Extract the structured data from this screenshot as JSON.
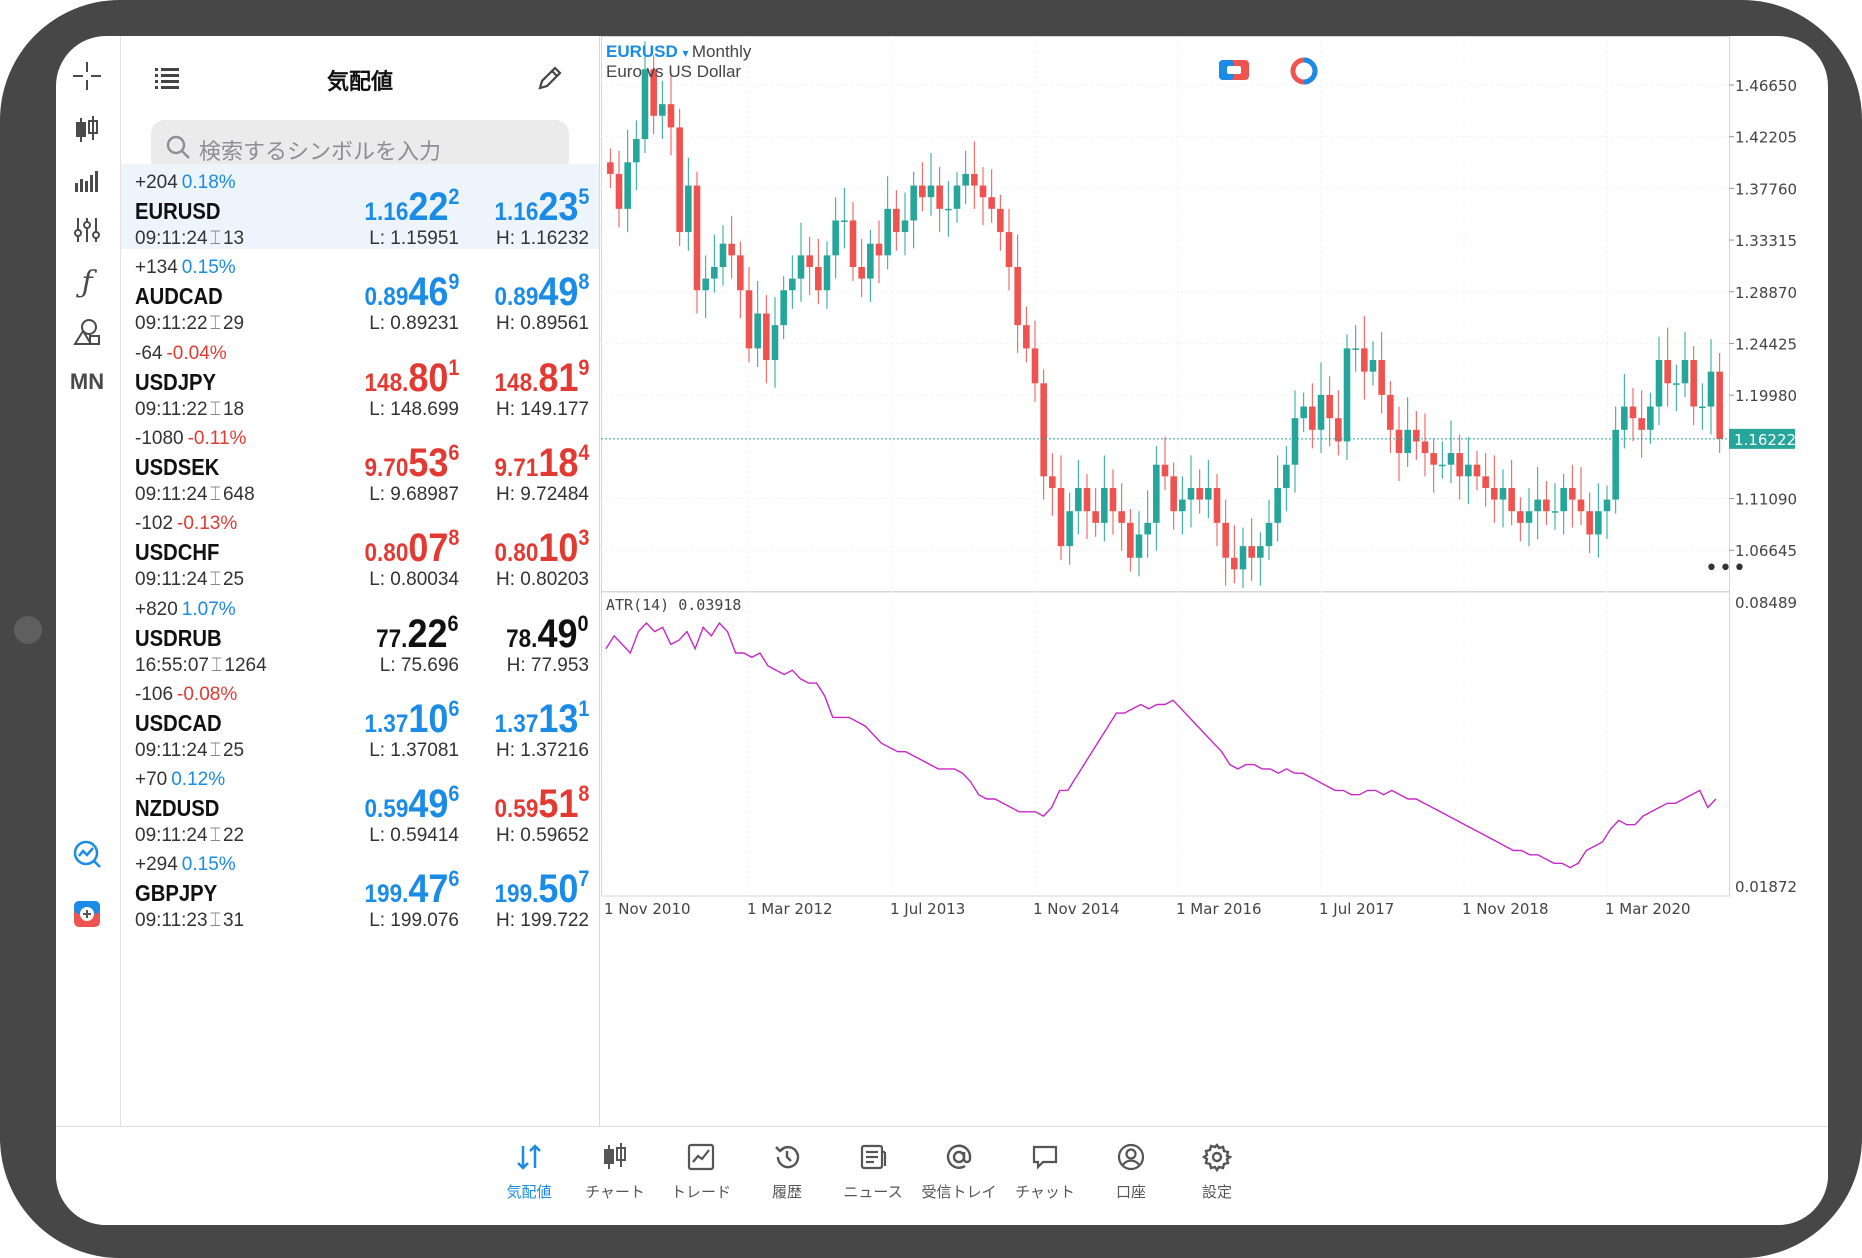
{
  "quotes_panel": {
    "title": "気配値",
    "search_placeholder": "検索するシンボルを入力",
    "rows": [
      {
        "change": "+204",
        "pct": "0.18%",
        "pct_color": "blue",
        "symbol": "EURUSD",
        "time": "09:11:24",
        "spread": "13",
        "bid": {
          "a": "1.16",
          "b": "22",
          "c": "2"
        },
        "ask": {
          "a": "1.16",
          "b": "23",
          "c": "5"
        },
        "price_color": "blue",
        "low": "L: 1.15951",
        "high": "H: 1.16232",
        "selected": true
      },
      {
        "change": "+134",
        "pct": "0.15%",
        "pct_color": "blue",
        "symbol": "AUDCAD",
        "time": "09:11:22",
        "spread": "29",
        "bid": {
          "a": "0.89",
          "b": "46",
          "c": "9"
        },
        "ask": {
          "a": "0.89",
          "b": "49",
          "c": "8"
        },
        "price_color": "blue",
        "low": "L: 0.89231",
        "high": "H: 0.89561"
      },
      {
        "change": "-64",
        "pct": "-0.04%",
        "pct_color": "red",
        "symbol": "USDJPY",
        "time": "09:11:22",
        "spread": "18",
        "bid": {
          "a": "148.",
          "b": "80",
          "c": "1"
        },
        "ask": {
          "a": "148.",
          "b": "81",
          "c": "9"
        },
        "price_color": "red",
        "low": "L: 148.699",
        "high": "H: 149.177"
      },
      {
        "change": "-1080",
        "pct": "-0.11%",
        "pct_color": "red",
        "symbol": "USDSEK",
        "time": "09:11:24",
        "spread": "648",
        "bid": {
          "a": "9.70",
          "b": "53",
          "c": "6"
        },
        "ask": {
          "a": "9.71",
          "b": "18",
          "c": "4"
        },
        "price_color": "red",
        "low": "L: 9.68987",
        "high": "H: 9.72484"
      },
      {
        "change": "-102",
        "pct": "-0.13%",
        "pct_color": "red",
        "symbol": "USDCHF",
        "time": "09:11:24",
        "spread": "25",
        "bid": {
          "a": "0.80",
          "b": "07",
          "c": "8"
        },
        "ask": {
          "a": "0.80",
          "b": "10",
          "c": "3"
        },
        "price_color": "red",
        "low": "L: 0.80034",
        "high": "H: 0.80203"
      },
      {
        "change": "+820",
        "pct": "1.07%",
        "pct_color": "blue",
        "symbol": "USDRUB",
        "time": "16:55:07",
        "spread": "1264",
        "bid": {
          "a": "77.",
          "b": "22",
          "c": "6"
        },
        "ask": {
          "a": "78.",
          "b": "49",
          "c": "0"
        },
        "price_color": "black",
        "low": "L: 75.696",
        "high": "H: 77.953"
      },
      {
        "change": "-106",
        "pct": "-0.08%",
        "pct_color": "red",
        "symbol": "USDCAD",
        "time": "09:11:24",
        "spread": "25",
        "bid": {
          "a": "1.37",
          "b": "10",
          "c": "6"
        },
        "ask": {
          "a": "1.37",
          "b": "13",
          "c": "1"
        },
        "price_color": "blue",
        "low": "L: 1.37081",
        "high": "H: 1.37216"
      },
      {
        "change": "+70",
        "pct": "0.12%",
        "pct_color": "blue",
        "symbol": "NZDUSD",
        "time": "09:11:24",
        "spread": "22",
        "bid": {
          "a": "0.59",
          "b": "49",
          "c": "6"
        },
        "ask": {
          "a": "0.59",
          "b": "51",
          "c": "8"
        },
        "price_color": "mixed",
        "low": "L: 0.59414",
        "high": "H: 0.59652"
      },
      {
        "change": "+294",
        "pct": "0.15%",
        "pct_color": "blue",
        "symbol": "GBPJPY",
        "time": "09:11:23",
        "spread": "31",
        "bid": {
          "a": "199.",
          "b": "47",
          "c": "6"
        },
        "ask": {
          "a": "199.",
          "b": "50",
          "c": "7"
        },
        "price_color": "blue",
        "low": "L: 199.076",
        "high": "H: 199.722"
      }
    ]
  },
  "toolbar": {
    "mn_label": "MN",
    "icons": [
      "crosshair-icon",
      "candlestick-icon",
      "bar-chart-icon",
      "indicators-icon",
      "function-icon",
      "objects-icon",
      "timeframe-mn",
      "trade-chart-icon",
      "one-click-trading-icon"
    ]
  },
  "chart": {
    "symbol": "EURUSD",
    "timeframe": "Monthly",
    "description": "Euro vs US Dollar",
    "current_price": "1.16222",
    "price_ticks": [
      "1.46650",
      "1.42205",
      "1.37760",
      "1.33315",
      "1.28870",
      "1.24425",
      "1.19980",
      "1.11090",
      "1.06645"
    ],
    "date_ticks": [
      "1 Nov 2010",
      "1 Mar 2012",
      "1 Jul 2013",
      "1 Nov 2014",
      "1 Mar 2016",
      "1 Jul 2017",
      "1 Nov 2018",
      "1 Mar 2020"
    ],
    "atr_label": "ATR(14) 0.03918",
    "atr_ticks": [
      "0.08489",
      "0.01872"
    ],
    "colors": {
      "up": "#26a69a",
      "down": "#ef5350",
      "atr": "#c728c7",
      "accent": "#1a8be6"
    }
  },
  "chart_data": {
    "type": "candlestick",
    "ylim": [
      1.04,
      1.5
    ],
    "atr_ylim": [
      0.01872,
      0.08489
    ],
    "close": [
      1.39,
      1.36,
      1.4,
      1.42,
      1.48,
      1.44,
      1.45,
      1.43,
      1.34,
      1.38,
      1.29,
      1.3,
      1.31,
      1.33,
      1.32,
      1.29,
      1.24,
      1.27,
      1.23,
      1.26,
      1.29,
      1.3,
      1.32,
      1.31,
      1.29,
      1.32,
      1.35,
      1.35,
      1.31,
      1.3,
      1.33,
      1.32,
      1.36,
      1.34,
      1.35,
      1.38,
      1.37,
      1.38,
      1.36,
      1.36,
      1.38,
      1.39,
      1.38,
      1.37,
      1.36,
      1.34,
      1.31,
      1.26,
      1.24,
      1.21,
      1.13,
      1.12,
      1.07,
      1.1,
      1.12,
      1.1,
      1.09,
      1.12,
      1.1,
      1.09,
      1.06,
      1.08,
      1.09,
      1.14,
      1.13,
      1.1,
      1.11,
      1.12,
      1.11,
      1.12,
      1.09,
      1.06,
      1.05,
      1.07,
      1.06,
      1.07,
      1.09,
      1.12,
      1.14,
      1.18,
      1.19,
      1.17,
      1.2,
      1.18,
      1.16,
      1.24,
      1.24,
      1.22,
      1.23,
      1.2,
      1.17,
      1.15,
      1.17,
      1.16,
      1.15,
      1.14,
      1.14,
      1.15,
      1.13,
      1.14,
      1.13,
      1.12,
      1.11,
      1.12,
      1.1,
      1.09,
      1.1,
      1.11,
      1.1,
      1.1,
      1.12,
      1.11,
      1.1,
      1.08,
      1.1,
      1.11,
      1.17,
      1.19,
      1.18,
      1.17,
      1.19,
      1.23,
      1.21,
      1.21,
      1.23,
      1.19,
      1.19,
      1.22,
      1.1622
    ],
    "atr": [
      0.074,
      0.077,
      0.075,
      0.073,
      0.078,
      0.08,
      0.078,
      0.079,
      0.075,
      0.076,
      0.078,
      0.074,
      0.079,
      0.077,
      0.08,
      0.078,
      0.073,
      0.073,
      0.072,
      0.073,
      0.07,
      0.069,
      0.068,
      0.069,
      0.067,
      0.066,
      0.066,
      0.063,
      0.058,
      0.058,
      0.058,
      0.057,
      0.056,
      0.054,
      0.052,
      0.051,
      0.05,
      0.05,
      0.049,
      0.048,
      0.047,
      0.046,
      0.046,
      0.046,
      0.045,
      0.043,
      0.04,
      0.039,
      0.039,
      0.038,
      0.037,
      0.036,
      0.036,
      0.036,
      0.035,
      0.037,
      0.041,
      0.041,
      0.044,
      0.047,
      0.05,
      0.053,
      0.056,
      0.059,
      0.059,
      0.06,
      0.061,
      0.06,
      0.061,
      0.061,
      0.062,
      0.06,
      0.058,
      0.056,
      0.054,
      0.052,
      0.05,
      0.047,
      0.046,
      0.047,
      0.047,
      0.046,
      0.046,
      0.045,
      0.046,
      0.045,
      0.045,
      0.044,
      0.043,
      0.042,
      0.041,
      0.041,
      0.04,
      0.04,
      0.041,
      0.041,
      0.04,
      0.041,
      0.04,
      0.039,
      0.039,
      0.038,
      0.037,
      0.036,
      0.035,
      0.034,
      0.033,
      0.032,
      0.031,
      0.03,
      0.029,
      0.028,
      0.027,
      0.027,
      0.026,
      0.026,
      0.025,
      0.024,
      0.024,
      0.023,
      0.024,
      0.027,
      0.028,
      0.029,
      0.032,
      0.034,
      0.033,
      0.033,
      0.035,
      0.036,
      0.037,
      0.038,
      0.038,
      0.039,
      0.04,
      0.041,
      0.037,
      0.039
    ]
  },
  "tabbar": {
    "tabs": [
      {
        "label": "気配値",
        "name": "tab-quotes",
        "active": true
      },
      {
        "label": "チャート",
        "name": "tab-chart"
      },
      {
        "label": "トレード",
        "name": "tab-trade"
      },
      {
        "label": "履歴",
        "name": "tab-history"
      },
      {
        "label": "ニュース",
        "name": "tab-news"
      },
      {
        "label": "受信トレイ",
        "name": "tab-mailbox"
      },
      {
        "label": "チャット",
        "name": "tab-chat"
      },
      {
        "label": "口座",
        "name": "tab-accounts"
      },
      {
        "label": "設定",
        "name": "tab-settings"
      }
    ]
  }
}
